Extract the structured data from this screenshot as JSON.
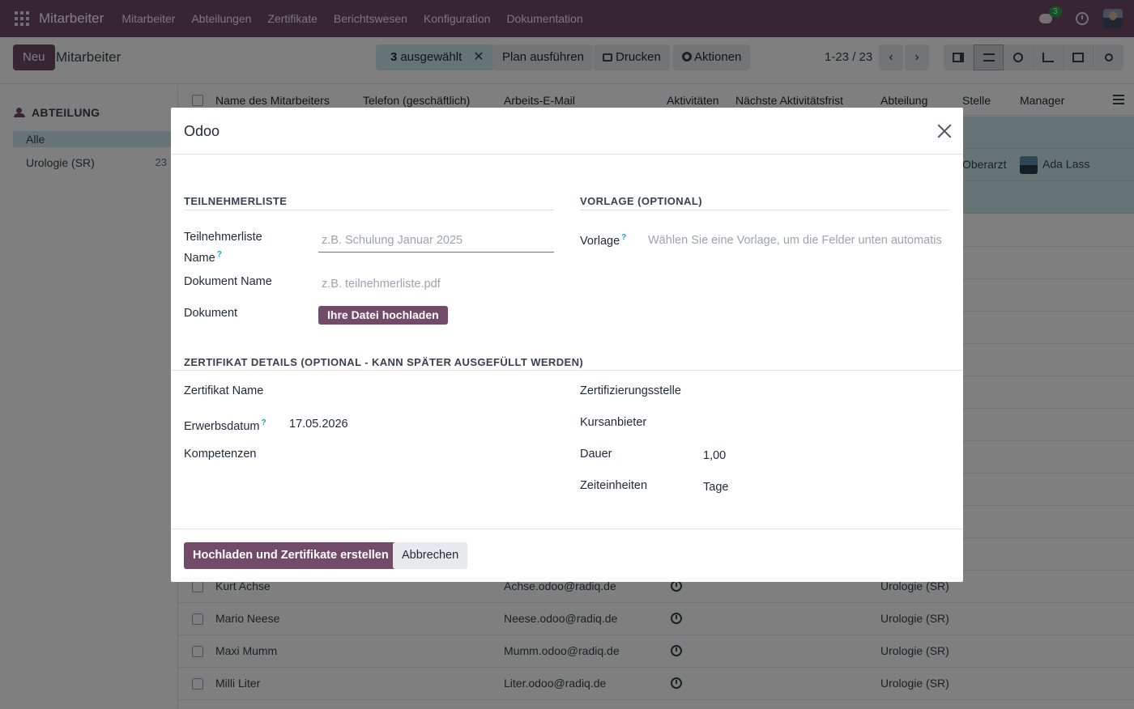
{
  "navbar": {
    "app_name": "Mitarbeiter",
    "menu": [
      "Mitarbeiter",
      "Abteilungen",
      "Zertifikate",
      "Berichtswesen",
      "Konfiguration",
      "Dokumentation"
    ],
    "chat_badge": "3"
  },
  "control_panel": {
    "new_label": "Neu",
    "title": "Mitarbeiter",
    "selected_count": "3",
    "selected_label": "ausgewählt",
    "plan_label": "Plan ausführen",
    "print_label": "Drucken",
    "actions_label": "Aktionen",
    "pager": "1-23 / 23"
  },
  "sidebar": {
    "heading": "ABTEILUNG",
    "items": [
      {
        "label": "Alle",
        "count": ""
      },
      {
        "label": "Urologie (SR)",
        "count": "23"
      }
    ]
  },
  "list": {
    "columns": [
      "Name des Mitarbeiters",
      "Telefon (geschäftlich)",
      "Arbeits-E-Mail",
      "Aktivitäten",
      "Nächste Aktivitätsfrist",
      "Abteilung",
      "Stelle",
      "Manager"
    ],
    "visible_row": {
      "stelle": "Oberarzt",
      "manager": "Ada Lass"
    },
    "rows": [
      {
        "name": "Kurt Achse",
        "email": "Achse.odoo@radiq.de",
        "department": "Urologie (SR)"
      },
      {
        "name": "Mario Neese",
        "email": "Neese.odoo@radiq.de",
        "department": "Urologie (SR)"
      },
      {
        "name": "Maxi Mumm",
        "email": "Mumm.odoo@radiq.de",
        "department": "Urologie (SR)"
      },
      {
        "name": "Milli Liter",
        "email": "Liter.odoo@radiq.de",
        "department": "Urologie (SR)"
      }
    ]
  },
  "modal": {
    "title": "Odoo",
    "section_participants": "TEILNEHMERLISTE",
    "section_template": "VORLAGE (OPTIONAL)",
    "list_name_label_1": "Teilnehmerliste",
    "list_name_label_2": "Name",
    "help_mark": "?",
    "list_name_placeholder": "z.B. Schulung Januar 2025",
    "doc_name_label": "Dokument Name",
    "doc_name_placeholder": "z.B. teilnehmerliste.pdf",
    "document_label": "Dokument",
    "upload_label": "Ihre Datei hochladen",
    "template_label": "Vorlage",
    "template_placeholder": "Wählen Sie eine Vorlage, um die Felder unten automatis",
    "section_certificate": "ZERTIFIKAT DETAILS (OPTIONAL - KANN SPÄTER AUSGEFÜLLT WERDEN)",
    "cert_name_label": "Zertifikat Name",
    "acq_date_label": "Erwerbsdatum",
    "acq_date_value": "17.05.2026",
    "skills_label": "Kompetenzen",
    "issuer_label": "Zertifizierungsstelle",
    "provider_label": "Kursanbieter",
    "duration_label": "Dauer",
    "duration_value": "1,00",
    "time_units_label": "Zeiteinheiten",
    "time_units_value": "Tage",
    "submit_label": "Hochladen und Zertifikate erstellen",
    "cancel_label": "Abbrechen"
  }
}
